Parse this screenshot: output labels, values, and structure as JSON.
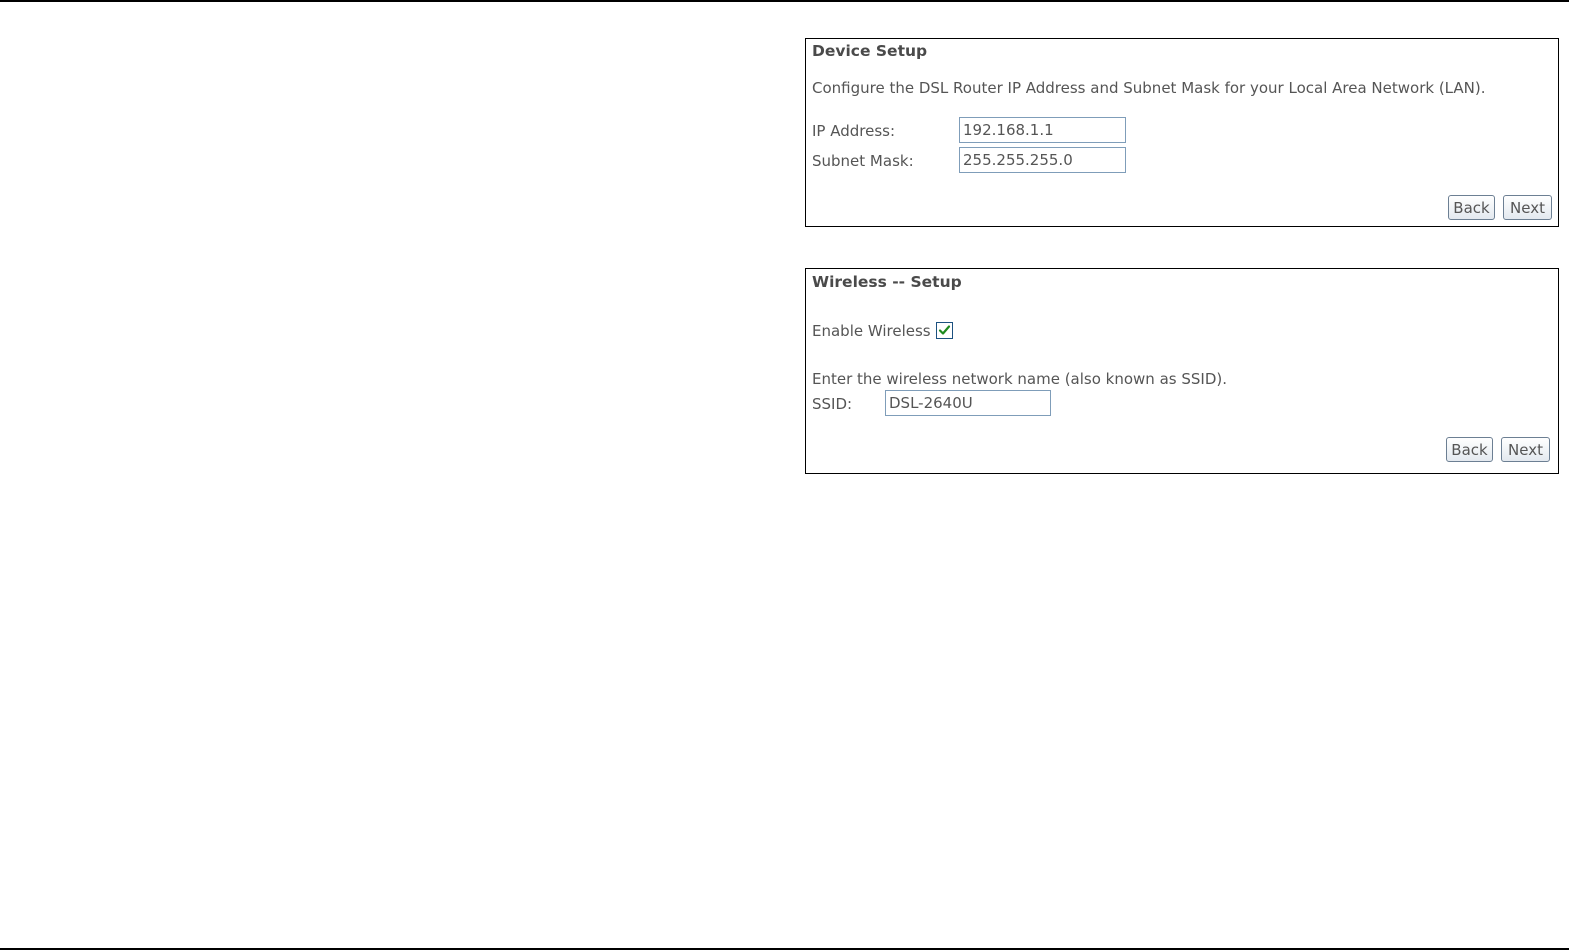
{
  "device_setup": {
    "title": "Device Setup",
    "description": "Configure the DSL Router IP Address and Subnet Mask for your Local Area Network (LAN).",
    "ip_label": "IP Address:",
    "ip_value": "192.168.1.1",
    "mask_label": "Subnet Mask:",
    "mask_value": "255.255.255.0",
    "back_label": "Back",
    "next_label": "Next"
  },
  "wireless_setup": {
    "title": "Wireless -- Setup",
    "enable_label": "Enable Wireless",
    "enable_checked": true,
    "ssid_prompt": "Enter the wireless network name (also known as SSID).",
    "ssid_label": "SSID:",
    "ssid_value": "DSL-2640U",
    "back_label": "Back",
    "next_label": "Next"
  },
  "colors": {
    "checkbox_check": "#1f8a1f",
    "panel_border": "#000000",
    "text": "#555555"
  },
  "icons": {
    "enable_checkbox": "checkmark-icon"
  }
}
